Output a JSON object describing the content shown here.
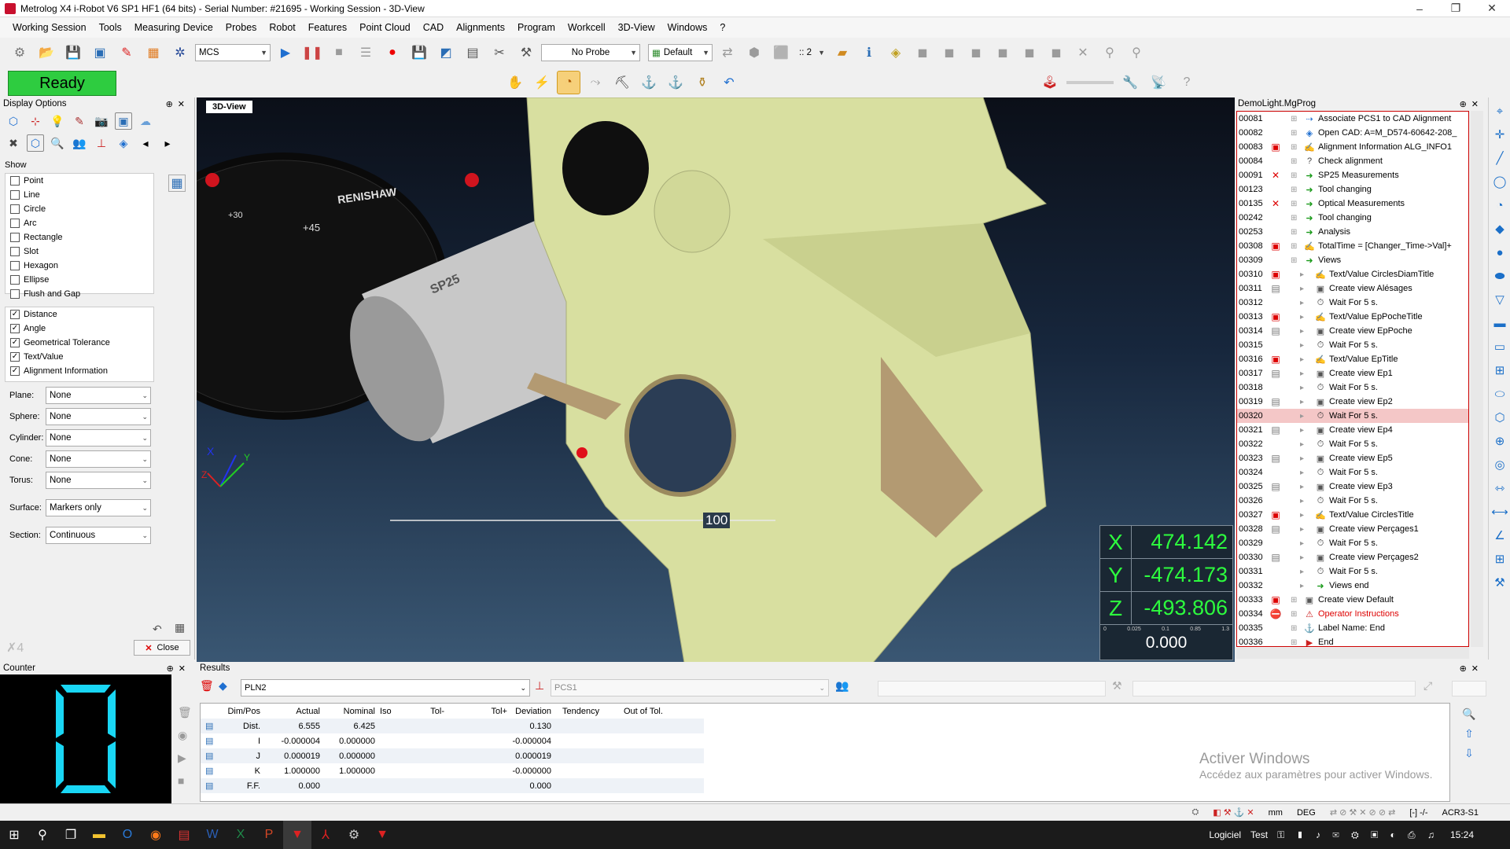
{
  "window": {
    "title": "Metrolog X4 i-Robot V6 SP1 HF1 (64 bits) - Serial Number: #21695 - Working Session - 3D-View"
  },
  "menu": [
    "Working Session",
    "Tools",
    "Measuring Device",
    "Probes",
    "Robot",
    "Features",
    "Point Cloud",
    "CAD",
    "Alignments",
    "Program",
    "Workcell",
    "3D-View",
    "Windows",
    "?"
  ],
  "toolbar": {
    "coord_system": "MCS",
    "probe": "No Probe",
    "view_mode": "Default",
    "zoom": ":: 2"
  },
  "status": {
    "ready": "Ready"
  },
  "display_options": {
    "title": "Display Options",
    "show_label": "Show",
    "features": [
      {
        "label": "Point",
        "checked": false
      },
      {
        "label": "Line",
        "checked": false
      },
      {
        "label": "Circle",
        "checked": false
      },
      {
        "label": "Arc",
        "checked": false
      },
      {
        "label": "Rectangle",
        "checked": false
      },
      {
        "label": "Slot",
        "checked": false
      },
      {
        "label": "Hexagon",
        "checked": false
      },
      {
        "label": "Ellipse",
        "checked": false
      },
      {
        "label": "Flush and Gap",
        "checked": false
      }
    ],
    "annotations": [
      {
        "label": "Distance",
        "checked": true
      },
      {
        "label": "Angle",
        "checked": true
      },
      {
        "label": "Geometrical Tolerance",
        "checked": true
      },
      {
        "label": "Text/Value",
        "checked": true
      },
      {
        "label": "Alignment Information",
        "checked": true
      }
    ],
    "dropdowns": [
      {
        "label": "Plane:",
        "value": "None"
      },
      {
        "label": "Sphere:",
        "value": "None"
      },
      {
        "label": "Cylinder:",
        "value": "None"
      },
      {
        "label": "Cone:",
        "value": "None"
      },
      {
        "label": "Torus:",
        "value": "None"
      },
      {
        "label": "Surface:",
        "value": "Markers only"
      },
      {
        "label": "Section:",
        "value": "Continuous"
      }
    ],
    "close_label": "Close"
  },
  "view3d": {
    "tab": "3D-View",
    "probe_brand": "RENISHAW",
    "probe_model": "SP25",
    "scale_label": "100",
    "axes": {
      "x": "X",
      "y": "Y",
      "z": "Z"
    },
    "dial_marks": [
      "+30",
      "+45"
    ],
    "coords": {
      "x": "474.142",
      "y": "-474.173",
      "z": "-493.806",
      "deviation": "0.000",
      "scale": [
        "0",
        "0.025",
        "0.1",
        "0.85",
        "1.3"
      ]
    }
  },
  "program": {
    "title": "DemoLight.MgProg",
    "rows": [
      {
        "num": "00081",
        "label": "Associate PCS1 to CAD Alignment",
        "status": "",
        "depth": 0
      },
      {
        "num": "00082",
        "label": "Open CAD: A=M_D574-60642-208_",
        "status": "",
        "depth": 0
      },
      {
        "num": "00083",
        "label": "Alignment Information ALG_INFO1",
        "status": "lock",
        "depth": 0
      },
      {
        "num": "00084",
        "label": "Check alignment",
        "status": "",
        "depth": 0
      },
      {
        "num": "00091",
        "label": "SP25 Measurements",
        "status": "x",
        "depth": 0
      },
      {
        "num": "00123",
        "label": "Tool changing",
        "status": "",
        "depth": 0
      },
      {
        "num": "00135",
        "label": "Optical Measurements",
        "status": "x",
        "depth": 0
      },
      {
        "num": "00242",
        "label": "Tool changing",
        "status": "",
        "depth": 0
      },
      {
        "num": "00253",
        "label": "Analysis",
        "status": "",
        "depth": 0
      },
      {
        "num": "00308",
        "label": "TotalTime = [Changer_Time->Val]+",
        "status": "lock",
        "depth": 0
      },
      {
        "num": "00309",
        "label": "Views",
        "status": "",
        "depth": 0
      },
      {
        "num": "00310",
        "label": "Text/Value CirclesDiamTitle",
        "status": "lock",
        "depth": 1
      },
      {
        "num": "00311",
        "label": "Create view Alésages",
        "status": "doc",
        "depth": 1
      },
      {
        "num": "00312",
        "label": "Wait For 5 s.",
        "status": "",
        "depth": 1
      },
      {
        "num": "00313",
        "label": "Text/Value EpPocheTitle",
        "status": "lock",
        "depth": 1
      },
      {
        "num": "00314",
        "label": "Create view EpPoche",
        "status": "doc",
        "depth": 1
      },
      {
        "num": "00315",
        "label": "Wait For 5 s.",
        "status": "",
        "depth": 1
      },
      {
        "num": "00316",
        "label": "Text/Value EpTitle",
        "status": "lock",
        "depth": 1
      },
      {
        "num": "00317",
        "label": "Create view Ep1",
        "status": "doc",
        "depth": 1
      },
      {
        "num": "00318",
        "label": "Wait For 5 s.",
        "status": "",
        "depth": 1
      },
      {
        "num": "00319",
        "label": "Create view Ep2",
        "status": "doc",
        "depth": 1
      },
      {
        "num": "00320",
        "label": "Wait For 5 s.",
        "status": "",
        "depth": 1,
        "selected": true
      },
      {
        "num": "00321",
        "label": "Create view Ep4",
        "status": "doc",
        "depth": 1
      },
      {
        "num": "00322",
        "label": "Wait For 5 s.",
        "status": "",
        "depth": 1
      },
      {
        "num": "00323",
        "label": "Create view Ep5",
        "status": "doc",
        "depth": 1
      },
      {
        "num": "00324",
        "label": "Wait For 5 s.",
        "status": "",
        "depth": 1
      },
      {
        "num": "00325",
        "label": "Create view Ep3",
        "status": "doc",
        "depth": 1
      },
      {
        "num": "00326",
        "label": "Wait For 5 s.",
        "status": "",
        "depth": 1
      },
      {
        "num": "00327",
        "label": "Text/Value CirclesTitle",
        "status": "lock",
        "depth": 1
      },
      {
        "num": "00328",
        "label": "Create view Perçages1",
        "status": "doc",
        "depth": 1
      },
      {
        "num": "00329",
        "label": "Wait For 5 s.",
        "status": "",
        "depth": 1
      },
      {
        "num": "00330",
        "label": "Create view Perçages2",
        "status": "doc",
        "depth": 1
      },
      {
        "num": "00331",
        "label": "Wait For 5 s.",
        "status": "",
        "depth": 1
      },
      {
        "num": "00332",
        "label": "Views end",
        "status": "",
        "depth": 1
      },
      {
        "num": "00333",
        "label": "Create view Default",
        "status": "lock",
        "depth": 0
      },
      {
        "num": "00334",
        "label": "Operator Instructions",
        "status": "stop",
        "depth": 0,
        "red": true
      },
      {
        "num": "00335",
        "label": "Label Name: End",
        "status": "",
        "depth": 0
      },
      {
        "num": "00336",
        "label": "End",
        "status": "",
        "depth": 0
      }
    ]
  },
  "counter": {
    "title": "Counter",
    "value": "0"
  },
  "results": {
    "title": "Results",
    "feature": "PLN2",
    "alignment": "PCS1",
    "columns": [
      "Dim/Pos",
      "Actual",
      "Nominal",
      "Iso",
      "Tol-",
      "Tol+",
      "Deviation",
      "Tendency",
      "Out of Tol."
    ],
    "rows": [
      {
        "dim": "Dist.",
        "actual": "6.555",
        "nominal": "6.425",
        "deviation": "0.130"
      },
      {
        "dim": "I",
        "actual": "-0.000004",
        "nominal": "0.000000",
        "deviation": "-0.000004"
      },
      {
        "dim": "J",
        "actual": "0.000019",
        "nominal": "0.000000",
        "deviation": "0.000019"
      },
      {
        "dim": "K",
        "actual": "1.000000",
        "nominal": "1.000000",
        "deviation": "-0.000000"
      },
      {
        "dim": "F.F.",
        "actual": "0.000",
        "nominal": "",
        "deviation": "0.000"
      }
    ]
  },
  "statusbar": {
    "units": "mm",
    "angle": "DEG",
    "mode": "[-] -/-",
    "robot": "ACR3-S1"
  },
  "watermark": {
    "line1": "Activer Windows",
    "line2": "Accédez aux paramètres pour activer Windows."
  },
  "taskbar": {
    "labels": [
      "Logiciel",
      "Test"
    ],
    "time": "15:24"
  },
  "colors": {
    "ready": "#2ecc40",
    "readout": "#2dfc3e",
    "counter": "#19d7f5",
    "part": "#d8dfa0",
    "selected_row": "#f4c7c7"
  }
}
